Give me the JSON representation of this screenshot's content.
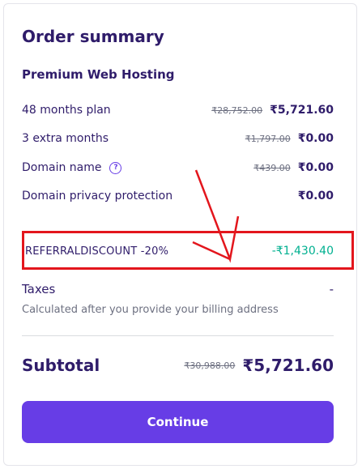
{
  "order_summary": {
    "title": "Order summary",
    "product_name": "Premium Web Hosting",
    "line_items": [
      {
        "label": "48 months plan",
        "original_price": "₹28,752.00",
        "price": "₹5,721.60"
      },
      {
        "label": "3 extra months",
        "original_price": "₹1,797.00",
        "price": "₹0.00"
      },
      {
        "label": "Domain name",
        "original_price": "₹439.00",
        "price": "₹0.00",
        "icon": "help-circle-icon"
      },
      {
        "label": "Domain privacy protection",
        "original_price": "",
        "price": "₹0.00"
      }
    ],
    "discount": {
      "label": "REFERRALDISCOUNT -20%",
      "amount": "-₹1,430.40"
    },
    "taxes": {
      "label": "Taxes",
      "value": "-",
      "note": "Calculated after you provide your billing address"
    },
    "subtotal": {
      "label": "Subtotal",
      "original_price": "₹30,988.00",
      "price": "₹5,721.60"
    },
    "continue_label": "Continue"
  },
  "colors": {
    "primary": "#673de6",
    "text": "#2f1c6a",
    "discount_green": "#00b090",
    "annotation_red": "#e3161d"
  }
}
